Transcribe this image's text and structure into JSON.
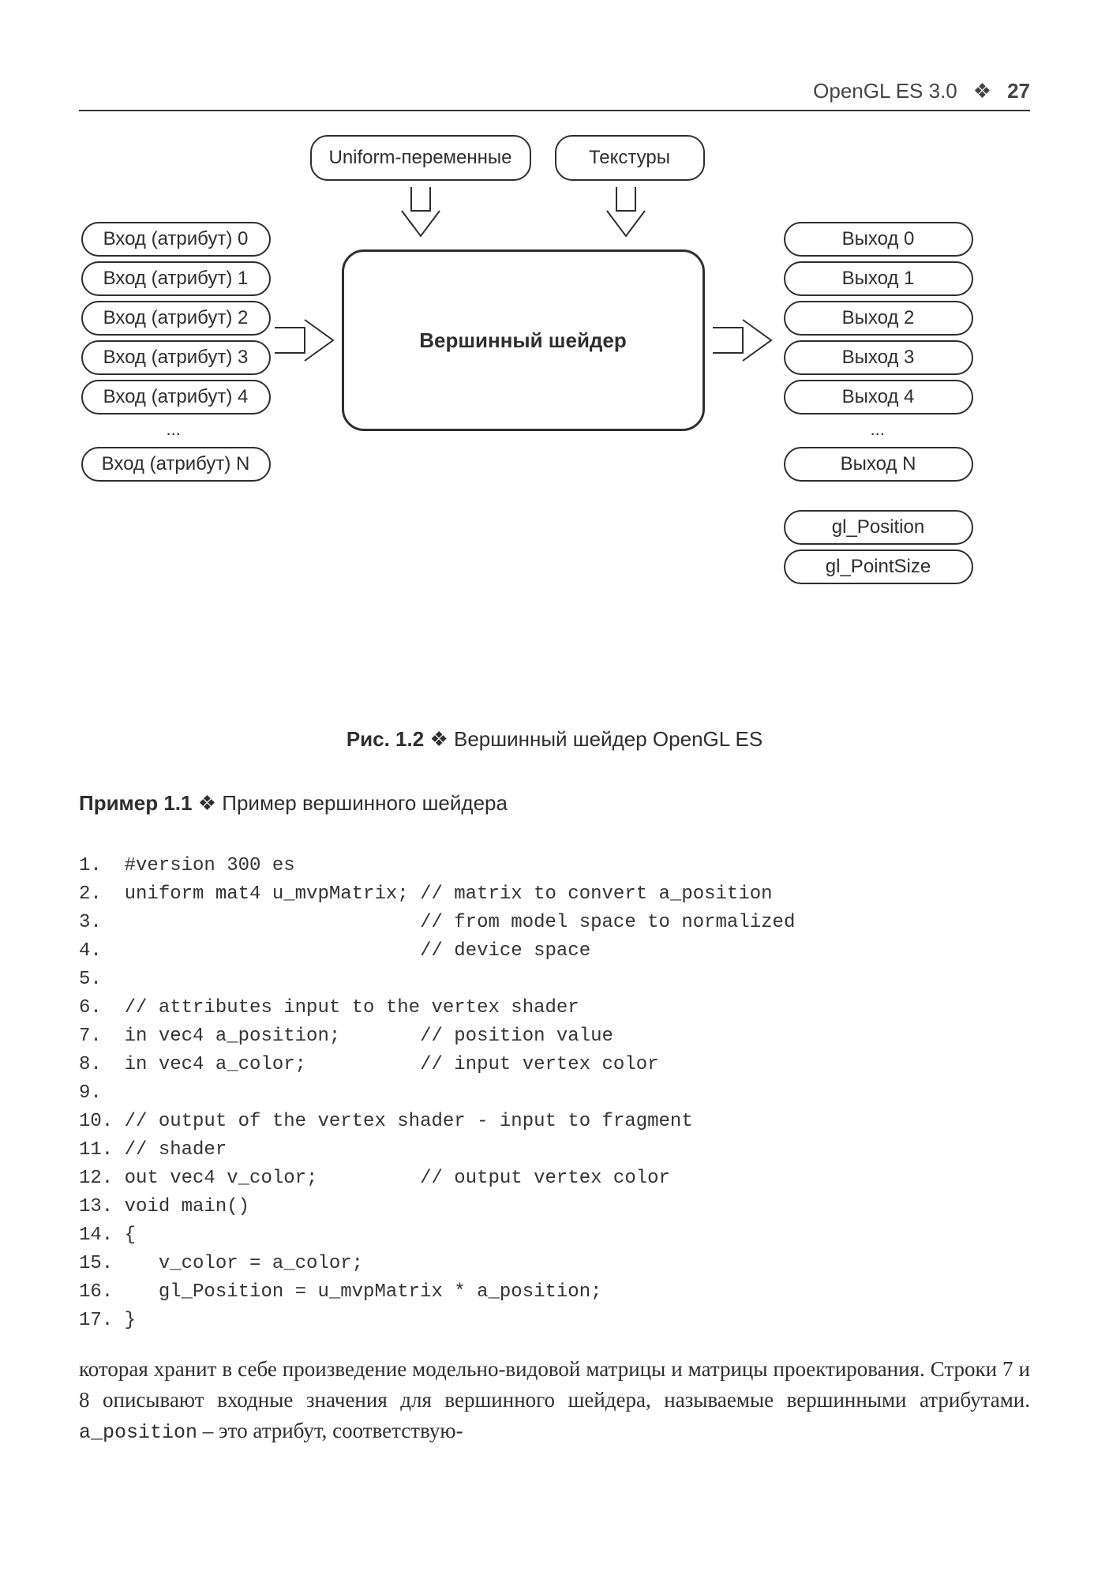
{
  "header": {
    "title": "OpenGL ES 3.0",
    "bullet": "❖",
    "page": "27"
  },
  "diagram": {
    "top_left": "Uniform-переменные",
    "top_right": "Текстуры",
    "center": "Вершинный шейдер",
    "inputs": [
      "Вход (атрибут) 0",
      "Вход (атрибут) 1",
      "Вход (атрибут) 2",
      "Вход (атрибут) 3",
      "Вход (атрибут) 4"
    ],
    "input_ell": "...",
    "input_last": "Вход (атрибут) N",
    "outputs": [
      "Выход 0",
      "Выход 1",
      "Выход 2",
      "Выход 3",
      "Выход 4"
    ],
    "output_ell": "...",
    "output_last": "Выход N",
    "gl_out1": "gl_Position",
    "gl_out2": "gl_PointSize"
  },
  "figure_caption": {
    "label": "Рис. 1.2",
    "bullet": "❖",
    "text": "Вершинный шейдер OpenGL ES"
  },
  "example_caption": {
    "label": "Пример 1.1",
    "bullet": "❖",
    "text": "Пример вершинного шейдера"
  },
  "code_lines": [
    "1.  #version 300 es",
    "2.  uniform mat4 u_mvpMatrix; // matrix to convert a_position",
    "3.                            // from model space to normalized",
    "4.                            // device space",
    "5.",
    "6.  // attributes input to the vertex shader",
    "7.  in vec4 a_position;       // position value",
    "8.  in vec4 a_color;          // input vertex color",
    "9.",
    "10. // output of the vertex shader - input to fragment",
    "11. // shader",
    "12. out vec4 v_color;         // output vertex color",
    "13. void main()",
    "14. {",
    "15.    v_color = a_color;",
    "16.    gl_Position = u_mvpMatrix * a_position;",
    "17. }"
  ],
  "body": {
    "part1": "которая хранит в себе произведение модельно-видовой матрицы и матрицы проектирования. Строки 7 и 8 описывают входные значения для вершинного шейдера, называемые вершинными атрибутами. ",
    "code": "a_position",
    "part2": " – это атрибут, соответствую-"
  }
}
